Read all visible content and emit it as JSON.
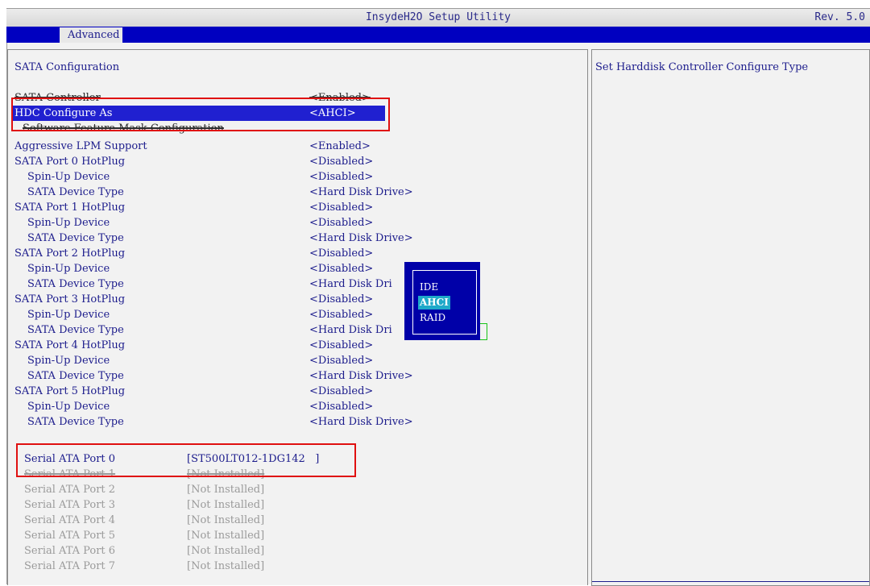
{
  "header": {
    "title": "InsydeH2O Setup Utility",
    "rev": "Rev. 5.0"
  },
  "menu": {
    "active_tab": "Advanced"
  },
  "page_title": "SATA Configuration",
  "help_text": "Set Harddisk Controller Configure Type",
  "settings": [
    {
      "label": "SATA Controller",
      "value": "<Enabled>"
    },
    {
      "label": "HDC Configure As",
      "value": "<AHCI>"
    },
    {
      "label": "Software Feature Mask Configuration",
      "value": ""
    },
    {
      "label": "Aggressive LPM Support",
      "value": "<Enabled>"
    },
    {
      "label": "SATA Port 0 HotPlug",
      "value": "<Disabled>"
    },
    {
      "label": "Spin-Up Device",
      "value": "<Disabled>"
    },
    {
      "label": "SATA Device Type",
      "value": "<Hard Disk Drive>"
    },
    {
      "label": "SATA Port 1 HotPlug",
      "value": "<Disabled>"
    },
    {
      "label": "Spin-Up Device",
      "value": "<Disabled>"
    },
    {
      "label": "SATA Device Type",
      "value": "<Hard Disk Drive>"
    },
    {
      "label": "SATA Port 2 HotPlug",
      "value": "<Disabled>"
    },
    {
      "label": "Spin-Up Device",
      "value": "<Disabled>"
    },
    {
      "label": "SATA Device Type",
      "value": "<Hard Disk Dri"
    },
    {
      "label": "SATA Port 3 HotPlug",
      "value": "<Disabled>"
    },
    {
      "label": "Spin-Up Device",
      "value": "<Disabled>"
    },
    {
      "label": "SATA Device Type",
      "value": "<Hard Disk Dri"
    },
    {
      "label": "SATA Port 4 HotPlug",
      "value": "<Disabled>"
    },
    {
      "label": "Spin-Up Device",
      "value": "<Disabled>"
    },
    {
      "label": "SATA Device Type",
      "value": "<Hard Disk Drive>"
    },
    {
      "label": "SATA Port 5 HotPlug",
      "value": "<Disabled>"
    },
    {
      "label": "Spin-Up Device",
      "value": "<Disabled>"
    },
    {
      "label": "SATA Device Type",
      "value": "<Hard Disk Drive>"
    }
  ],
  "popup": {
    "options": [
      "IDE",
      "AHCI",
      "RAID"
    ],
    "selected": "AHCI"
  },
  "sata_ports": [
    {
      "label": "Serial ATA Port 0",
      "value": "[ST500LT012-1DG142   ]"
    },
    {
      "label": "Serial ATA Port 1",
      "value": "[Not Installed]"
    },
    {
      "label": "Serial ATA Port 2",
      "value": "[Not Installed]"
    },
    {
      "label": "Serial ATA Port 3",
      "value": "[Not Installed]"
    },
    {
      "label": "Serial ATA Port 4",
      "value": "[Not Installed]"
    },
    {
      "label": "Serial ATA Port 5",
      "value": "[Not Installed]"
    },
    {
      "label": "Serial ATA Port 6",
      "value": "[Not Installed]"
    },
    {
      "label": "Serial ATA Port 7",
      "value": "[Not Installed]"
    }
  ],
  "colors": {
    "menu_bar": "#0000c0",
    "highlight": "#2020d0",
    "popup_bg": "#0000a8",
    "popup_selected": "#1fa9c9",
    "annotation_box": "#e01010",
    "text": "#1c1c8c"
  }
}
